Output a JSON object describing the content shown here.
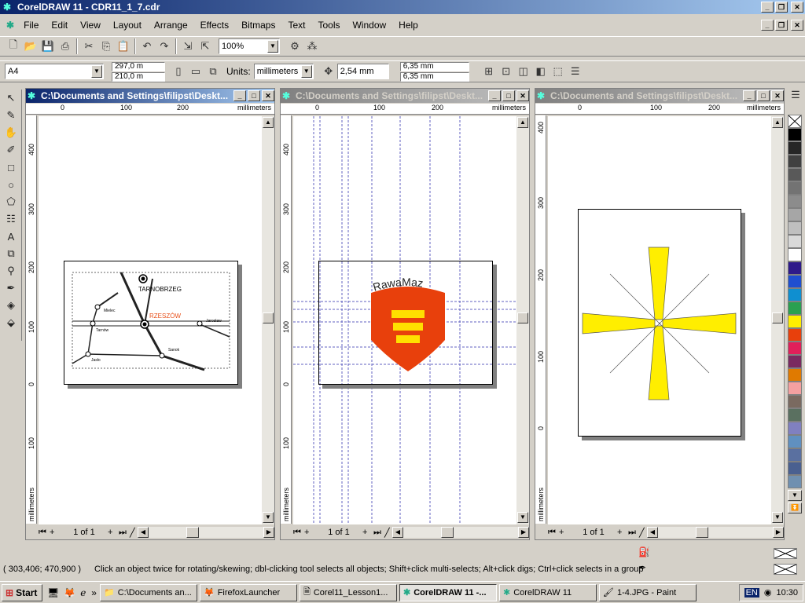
{
  "app": {
    "title": "CorelDRAW 11 - CDR11_1_7.cdr",
    "colors": {
      "title_active": "#0a246a",
      "accent": "#a6caf0"
    }
  },
  "menu": [
    "File",
    "Edit",
    "View",
    "Layout",
    "Arrange",
    "Effects",
    "Bitmaps",
    "Text",
    "Tools",
    "Window",
    "Help"
  ],
  "standard_toolbar": {
    "zoom": "100%"
  },
  "property_bar": {
    "paper": "A4",
    "width": "297,0 m",
    "height": "210,0 m",
    "units_label": "Units:",
    "units": "millimeters",
    "nudge": "2,54 mm",
    "dup_x": "6,35 mm",
    "dup_y": "6,35 mm"
  },
  "windows": [
    {
      "title": "C:\\Documents and Settings\\filipst\\Deskt...",
      "active": true,
      "ruler_unit": "millimeters",
      "h_ticks": [
        "0",
        "100",
        "200"
      ],
      "v_ticks": [
        "400",
        "300",
        "200",
        "100",
        "0",
        "100"
      ],
      "page_label": "1 of 1",
      "map": {
        "cities": [
          "TARNOBRZEG",
          "RZESZÓW",
          "Mielec",
          "Tarnów",
          "Jasło",
          "Sanok",
          "Jarosław"
        ],
        "highlight_color": "#e8501a"
      }
    },
    {
      "title": "C:\\Documents and Settings\\filipst\\Deskt...",
      "active": false,
      "ruler_unit": "millimeters",
      "h_ticks": [
        "0",
        "100",
        "200"
      ],
      "v_ticks": [
        "400",
        "300",
        "200",
        "100",
        "0",
        "100"
      ],
      "page_label": "1 of 1",
      "logo": {
        "text": "RawaMaz",
        "shield_color": "#e8400c",
        "bar_color": "#ffe000"
      }
    },
    {
      "title": "C:\\Documents and Settings\\filipst\\Deskt...",
      "active": false,
      "ruler_unit": "millimeters",
      "h_ticks": [
        "0",
        "100",
        "200"
      ],
      "v_ticks": [
        "400",
        "300",
        "200",
        "100",
        "0"
      ],
      "page_label": "1 of 1",
      "star_color": "#ffee00"
    }
  ],
  "palette": [
    "#000000",
    "#262626",
    "#404040",
    "#595959",
    "#737373",
    "#8c8c8c",
    "#a6a6a6",
    "#bfbfbf",
    "#d9d9d9",
    "#ffffff",
    "#2e1a8a",
    "#1f4fd0",
    "#0f8fd0",
    "#2aa050",
    "#ffee00",
    "#e8400c",
    "#e0205a",
    "#7a2a60",
    "#e07a00",
    "#f4a0a0",
    "#7a6a60",
    "#5a7060",
    "#8080c0",
    "#6090c0",
    "#5a70a0",
    "#4a6090",
    "#7090b0"
  ],
  "status": {
    "coords": "( 303,406; 470,900 )",
    "message": "Click an object twice for rotating/skewing; dbl-clicking tool selects all objects; Shift+click multi-selects; Alt+click digs; Ctrl+click selects in a group"
  },
  "taskbar": {
    "start": "Start",
    "tasks": [
      "C:\\Documents an...",
      "FirefoxLauncher",
      "Corel11_Lesson1...",
      "CorelDRAW 11 -...",
      "CorelDRAW 11",
      "1-4.JPG - Paint"
    ],
    "active_index": 3,
    "lang": "EN",
    "clock": "10:30"
  }
}
